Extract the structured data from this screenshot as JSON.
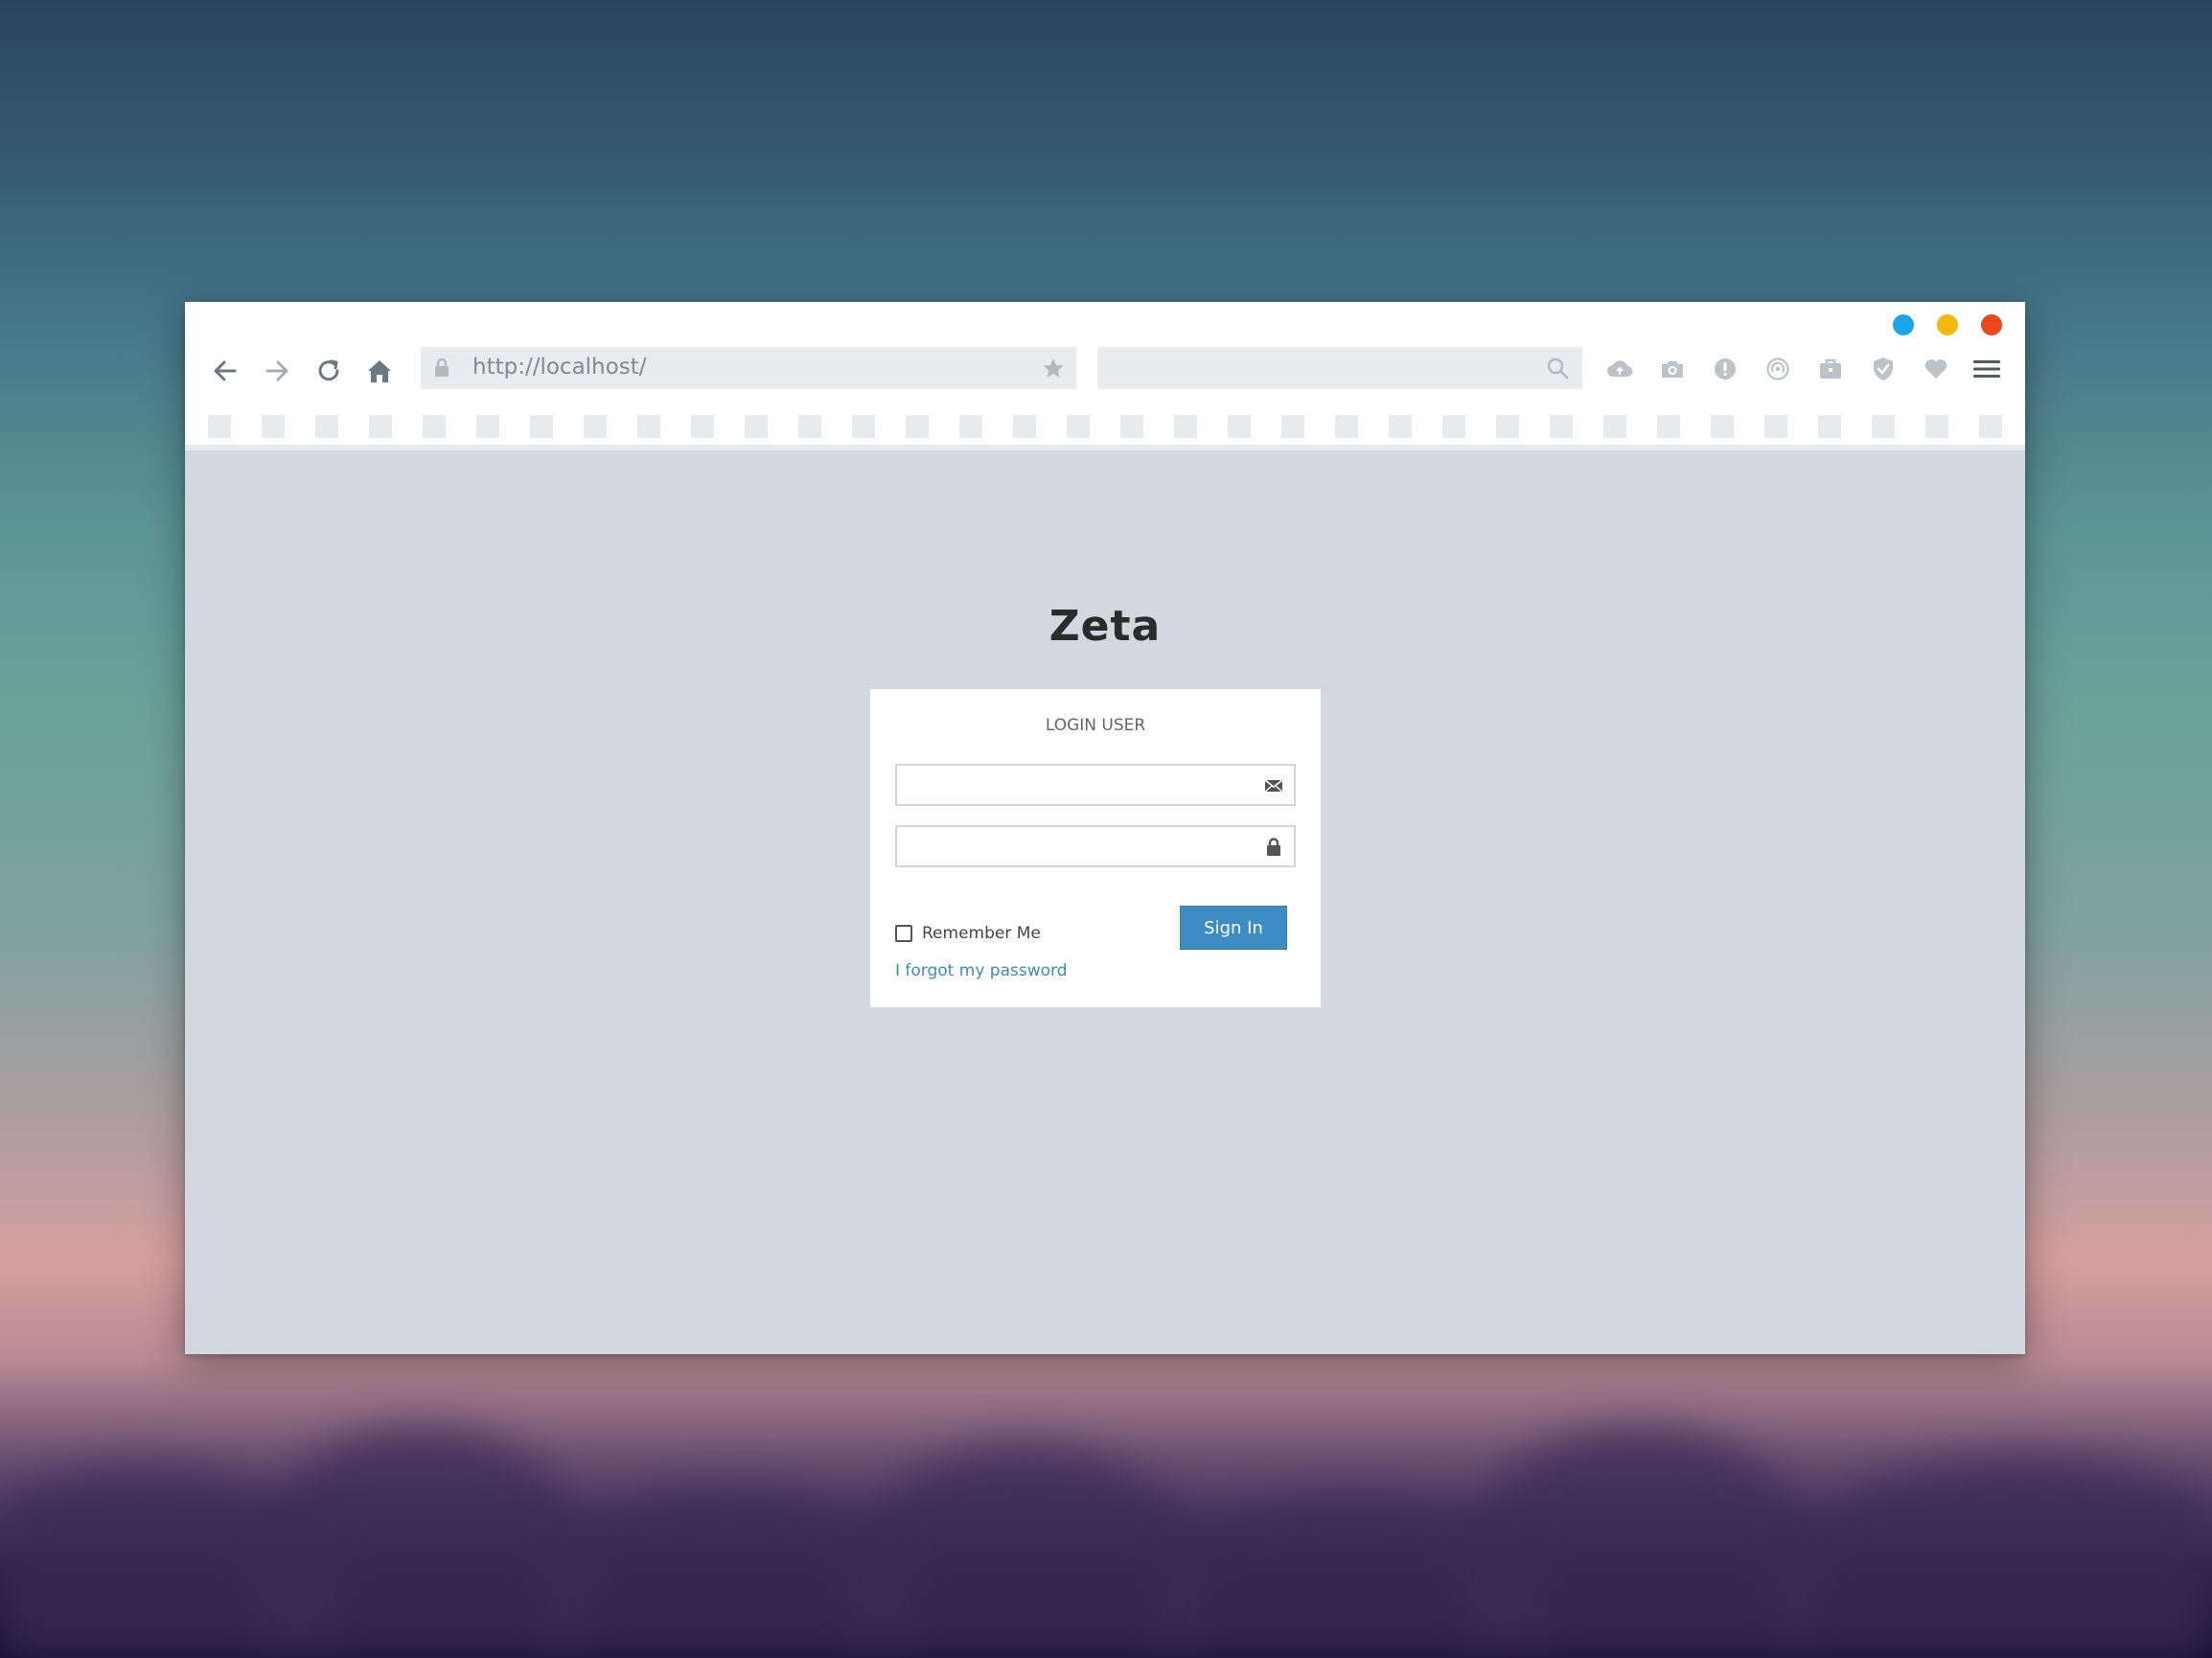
{
  "browser": {
    "url": "http://localhost/",
    "search_placeholder": "",
    "traffic_colors": {
      "blue": "#1ba5ea",
      "yellow": "#f5b712",
      "red": "#e9491d"
    }
  },
  "toolbar": {
    "nav_icons": [
      "back-arrow-icon",
      "forward-arrow-icon",
      "reload-icon",
      "home-icon"
    ],
    "tool_icons": [
      "cloud-upload-icon",
      "camera-icon",
      "alert-icon",
      "wifi-icon",
      "briefcase-icon",
      "shield-icon",
      "heart-icon",
      "menu-icon"
    ]
  },
  "page": {
    "title": "Zeta",
    "login": {
      "heading": "LOGIN USER",
      "email_placeholder": "",
      "password_placeholder": "",
      "remember_label": "Remember Me",
      "signin_label": "Sign In",
      "forgot_label": "I forgot my password"
    },
    "accent": "#3d8cc3"
  }
}
